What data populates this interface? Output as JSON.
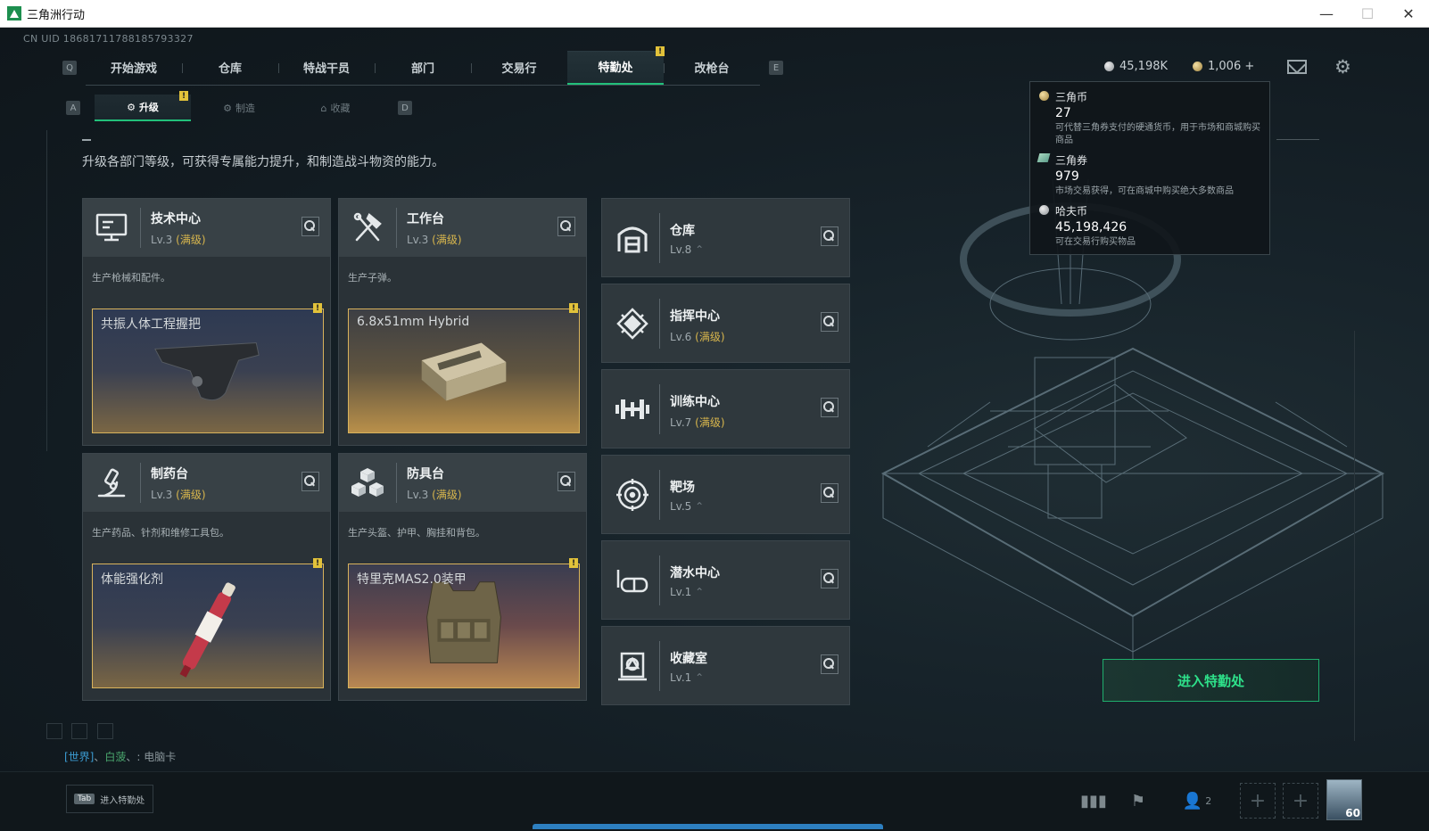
{
  "window": {
    "title": "三角洲行动"
  },
  "uid": "CN UID 18681711788185793327",
  "nav": {
    "left_key": "Q",
    "right_key": "E",
    "tabs": [
      "开始游戏",
      "仓库",
      "特战干员",
      "部门",
      "交易行",
      "特勤处",
      "改枪台"
    ],
    "active": "特勤处",
    "alert": "!"
  },
  "currency": {
    "havoc": "45,198K",
    "coin": "1,006 +"
  },
  "subnav": {
    "left_key": "A",
    "right_key": "D",
    "tabs": [
      "升级",
      "制造",
      "收藏"
    ],
    "active": "升级",
    "alert": "!"
  },
  "page_desc": "升级各部门等级，可获得专属能力提升，和制造战斗物资的能力。",
  "big_cards": [
    {
      "name": "技术中心",
      "level": "Lv.3",
      "max": "(满级)",
      "desc": "生产枪械和配件。",
      "product": "共振人体工程握把",
      "icon": "monitor-icon"
    },
    {
      "name": "工作台",
      "level": "Lv.3",
      "max": "(满级)",
      "desc": "生产子弹。",
      "product": "6.8x51mm Hybrid",
      "icon": "hammer-wrench-icon"
    },
    {
      "name": "制药台",
      "level": "Lv.3",
      "max": "(满级)",
      "desc": "生产药品、针剂和维修工具包。",
      "product": "体能强化剂",
      "icon": "microscope-icon"
    },
    {
      "name": "防具台",
      "level": "Lv.3",
      "max": "(满级)",
      "desc": "生产头盔、护甲、胸挂和背包。",
      "product": "特里克MAS2.0装甲",
      "icon": "cubes-icon"
    }
  ],
  "small_cards": [
    {
      "name": "仓库",
      "level": "Lv.8",
      "max": "",
      "up": "⌃",
      "icon": "warehouse-icon"
    },
    {
      "name": "指挥中心",
      "level": "Lv.6",
      "max": "(满级)",
      "up": "",
      "icon": "command-icon"
    },
    {
      "name": "训练中心",
      "level": "Lv.7",
      "max": "(满级)",
      "up": "",
      "icon": "dumbbell-icon"
    },
    {
      "name": "靶场",
      "level": "Lv.5",
      "max": "",
      "up": "⌃",
      "icon": "target-icon"
    },
    {
      "name": "潜水中心",
      "level": "Lv.1",
      "max": "",
      "up": "⌃",
      "icon": "diving-mask-icon"
    },
    {
      "name": "收藏室",
      "level": "Lv.1",
      "max": "",
      "up": "⌃",
      "icon": "collection-icon"
    }
  ],
  "tooltip": [
    {
      "name": "三角币",
      "value": "27",
      "desc": "可代替三角券支付的硬通货币，用于市场和商城购买商品"
    },
    {
      "name": "三角券",
      "value": "979",
      "desc": "市场交易获得，可在商城中购买绝大多数商品"
    },
    {
      "name": "哈夫币",
      "value": "45,198,426",
      "desc": "可在交易行购买物品"
    }
  ],
  "enter_button": "进入特勤处",
  "chat": {
    "channel": "[世界]",
    "sep": "、",
    "user": "白菠",
    "message": "电脑卡"
  },
  "bottom": {
    "tab_key": "Tab",
    "tab_label": "进入特勤处",
    "friends_count": "2",
    "avatar_level": "60"
  },
  "colors": {
    "accent": "#22c07a",
    "max_level": "#d8b64d",
    "alert": "#e2c23a"
  }
}
